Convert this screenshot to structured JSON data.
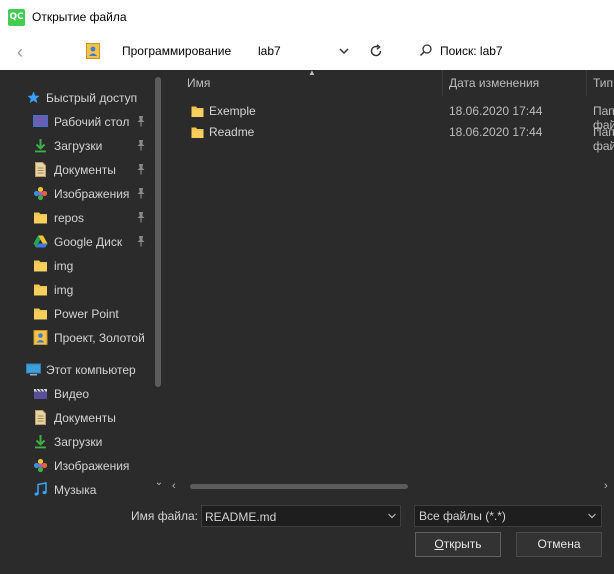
{
  "window": {
    "title": "Открытие файла",
    "app_icon_text": "QC"
  },
  "navbar": {
    "breadcrumbs": [
      "Программирование",
      "lab7"
    ],
    "search_placeholder": "Поиск: lab7"
  },
  "sidebar": {
    "quick_access": {
      "label": "Быстрый доступ",
      "icon": "star-icon"
    },
    "quick_items": [
      {
        "label": "Рабочий стол",
        "icon": "desktop-icon",
        "pinned": true
      },
      {
        "label": "Загрузки",
        "icon": "download-icon",
        "pinned": true
      },
      {
        "label": "Документы",
        "icon": "document-icon",
        "pinned": true
      },
      {
        "label": "Изображения",
        "icon": "pictures-icon",
        "pinned": true
      },
      {
        "label": "repos",
        "icon": "folder-icon",
        "pinned": true
      },
      {
        "label": "Google Диск",
        "icon": "google-drive-icon",
        "pinned": true
      },
      {
        "label": "img",
        "icon": "folder-icon",
        "pinned": false
      },
      {
        "label": "img",
        "icon": "folder-icon",
        "pinned": false
      },
      {
        "label": "Power Point",
        "icon": "folder-icon",
        "pinned": false
      },
      {
        "label": "Проект, Золотой",
        "icon": "contact-folder-icon",
        "pinned": false
      }
    ],
    "this_pc": {
      "label": "Этот компьютер",
      "icon": "computer-icon"
    },
    "pc_items": [
      {
        "label": "Видео",
        "icon": "video-icon"
      },
      {
        "label": "Документы",
        "icon": "document-icon"
      },
      {
        "label": "Загрузки",
        "icon": "download-icon"
      },
      {
        "label": "Изображения",
        "icon": "pictures-icon"
      },
      {
        "label": "Музыка",
        "icon": "music-icon"
      }
    ]
  },
  "filelist": {
    "columns": {
      "name": "Имя",
      "date": "Дата изменения",
      "type": "Тип"
    },
    "rows": [
      {
        "name": "Exemple",
        "date": "18.06.2020 17:44",
        "type": "Папка с файлами",
        "icon": "folder-icon"
      },
      {
        "name": "Readme",
        "date": "18.06.2020 17:44",
        "type": "Папка с файлами",
        "icon": "folder-icon"
      }
    ]
  },
  "footer": {
    "filename_label": "Имя файла:",
    "filename_value": "README.md",
    "filetype_value": "Все файлы (*.*)",
    "open_underlined": "О",
    "open_rest": "ткрыть",
    "cancel_label": "Отмена"
  },
  "colors": {
    "background": "#2b2b2b",
    "header_bar": "#ffffff",
    "folder": "#f4c34a",
    "text": "#d4d4d4"
  }
}
